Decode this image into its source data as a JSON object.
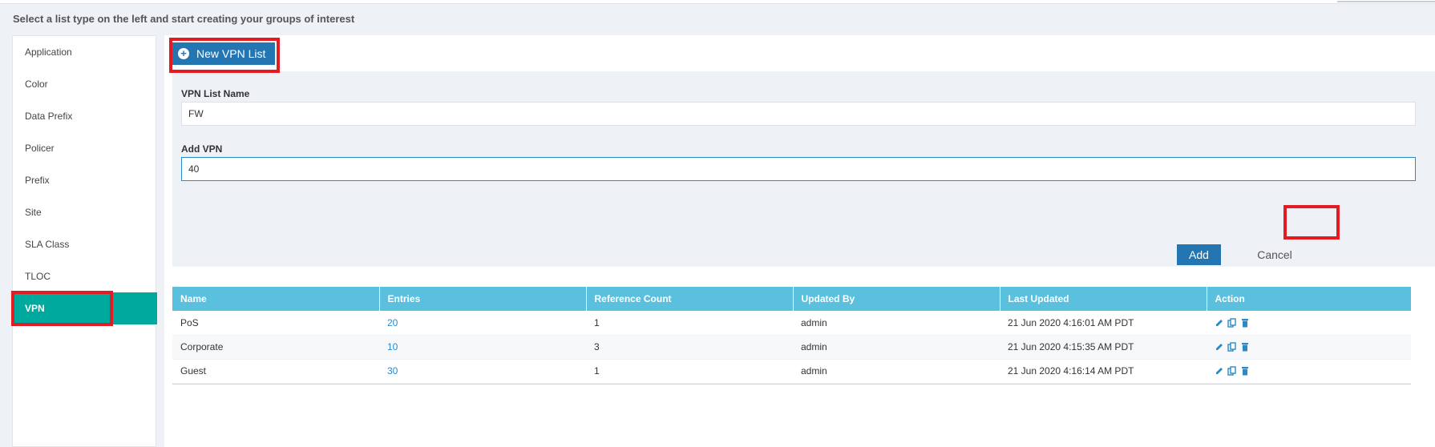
{
  "instruction": "Select a list type on the left and start creating your groups of interest",
  "sidebar": {
    "items": [
      {
        "label": "Application"
      },
      {
        "label": "Color"
      },
      {
        "label": "Data Prefix"
      },
      {
        "label": "Policer"
      },
      {
        "label": "Prefix"
      },
      {
        "label": "Site"
      },
      {
        "label": "SLA Class"
      },
      {
        "label": "TLOC"
      },
      {
        "label": "VPN",
        "active": true
      }
    ]
  },
  "toolbar": {
    "new_button_label": "New VPN List",
    "new_button_icon": "plus-circle-icon"
  },
  "form": {
    "name_label": "VPN List Name",
    "name_value": "FW",
    "vpn_label": "Add VPN",
    "vpn_value": "40",
    "add_label": "Add",
    "cancel_label": "Cancel"
  },
  "table": {
    "columns": [
      "Name",
      "Entries",
      "Reference Count",
      "Updated By",
      "Last Updated",
      "Action"
    ],
    "rows": [
      {
        "name": "PoS",
        "entries": "20",
        "reference_count": "1",
        "updated_by": "admin",
        "last_updated": "21 Jun 2020 4:16:01 AM PDT"
      },
      {
        "name": "Corporate",
        "entries": "10",
        "reference_count": "3",
        "updated_by": "admin",
        "last_updated": "21 Jun 2020 4:15:35 AM PDT"
      },
      {
        "name": "Guest",
        "entries": "30",
        "reference_count": "1",
        "updated_by": "admin",
        "last_updated": "21 Jun 2020 4:16:14 AM PDT"
      }
    ],
    "action_icons": [
      "edit-icon",
      "copy-icon",
      "delete-icon"
    ]
  },
  "colors": {
    "accent_teal": "#00a99d",
    "button_blue": "#2476b3",
    "header_blue": "#5bc0de",
    "highlight_red": "#e31b23"
  }
}
